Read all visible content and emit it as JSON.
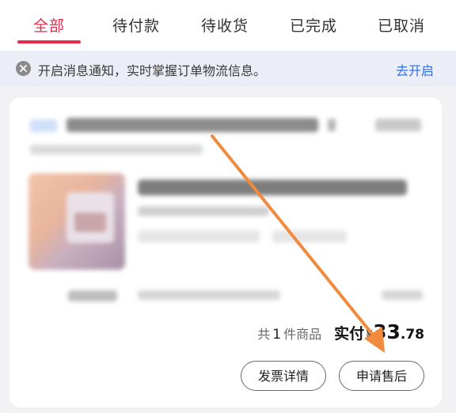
{
  "tabs": [
    {
      "label": "全部",
      "active": true
    },
    {
      "label": "待付款",
      "active": false
    },
    {
      "label": "待收货",
      "active": false
    },
    {
      "label": "已完成",
      "active": false
    },
    {
      "label": "已取消",
      "active": false
    }
  ],
  "notice": {
    "close_icon": "close-circle-icon",
    "text": "开启消息通知，实时掌握订单物流信息。",
    "action_label": "去开启"
  },
  "order": {
    "count_prefix": "共",
    "count": "1",
    "count_suffix": "件商品",
    "paid_label": "实付",
    "currency": "¥",
    "amount_int": "33",
    "amount_dec": ".78",
    "buttons": {
      "invoice": "发票详情",
      "aftersale": "申请售后"
    }
  },
  "colors": {
    "accent": "#e8294c",
    "link": "#2f6fe0",
    "annotation_arrow": "#f08a3c"
  }
}
